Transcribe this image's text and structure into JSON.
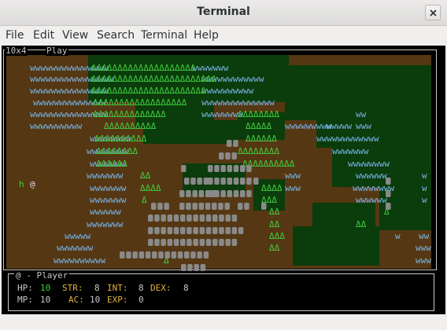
{
  "window": {
    "title": "Terminal"
  },
  "menu": [
    "File",
    "Edit",
    "View",
    "Search",
    "Terminal",
    "Help"
  ],
  "panel": {
    "size_label": "10x4",
    "mode_label": "Play"
  },
  "map": {
    "player_glyph": "@",
    "npc_glyph": "h",
    "water_glyph": "w",
    "tree_glyph": "Δ",
    "colors": {
      "dirt": "#553813",
      "grass": "#0b3c0b",
      "water": "#79b4e8",
      "tree": "#3fcf3f",
      "rock": "#8a8a8a",
      "npc": "#3fcf3f",
      "player": "#e0e0e0"
    }
  },
  "player_panel": {
    "header": "@ - Player",
    "hp_label": "HP:",
    "hp_value": "10",
    "str_label": "STR:",
    "str_value": "8",
    "int_label": "INT:",
    "int_value": "8",
    "dex_label": "DEX:",
    "dex_value": "8",
    "mp_label": "MP:",
    "mp_value": "10",
    "ac_label": "AC:",
    "ac_value": "10",
    "exp_label": "EXP:",
    "exp_value": "0"
  }
}
